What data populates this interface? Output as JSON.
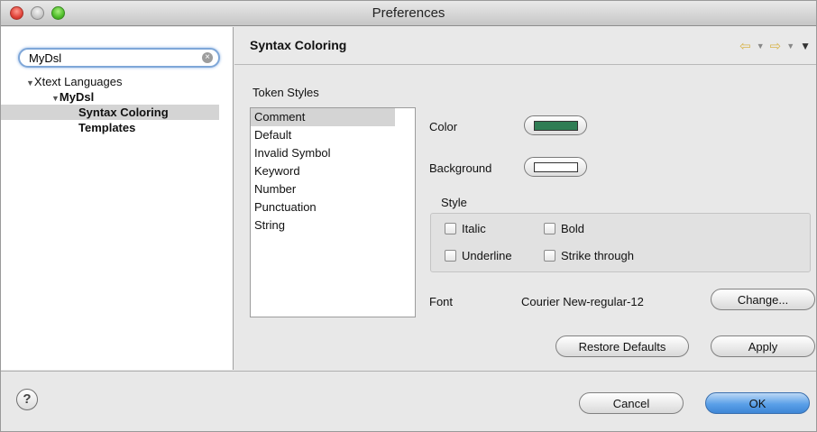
{
  "window": {
    "title": "Preferences"
  },
  "search": {
    "value": "MyDsl"
  },
  "tree": [
    {
      "label": "Xtext Languages"
    },
    {
      "label": "MyDsl"
    },
    {
      "label": "Syntax Coloring"
    },
    {
      "label": "Templates"
    }
  ],
  "header": {
    "title": "Syntax Coloring"
  },
  "tokens": {
    "heading": "Token Styles",
    "items": [
      "Comment",
      "Default",
      "Invalid Symbol",
      "Keyword",
      "Number",
      "Punctuation",
      "String"
    ],
    "selected": "Comment"
  },
  "color": {
    "label": "Color",
    "value": "#2f7d54"
  },
  "background": {
    "label": "Background",
    "value": "#ffffff"
  },
  "style": {
    "title": "Style",
    "italic": "Italic",
    "bold": "Bold",
    "underline": "Underline",
    "strike": "Strike through"
  },
  "font": {
    "label": "Font",
    "value": "Courier New-regular-12",
    "change_label": "Change..."
  },
  "buttons": {
    "restore": "Restore Defaults",
    "apply": "Apply",
    "cancel": "Cancel",
    "ok": "OK"
  },
  "help": {
    "glyph": "?"
  }
}
